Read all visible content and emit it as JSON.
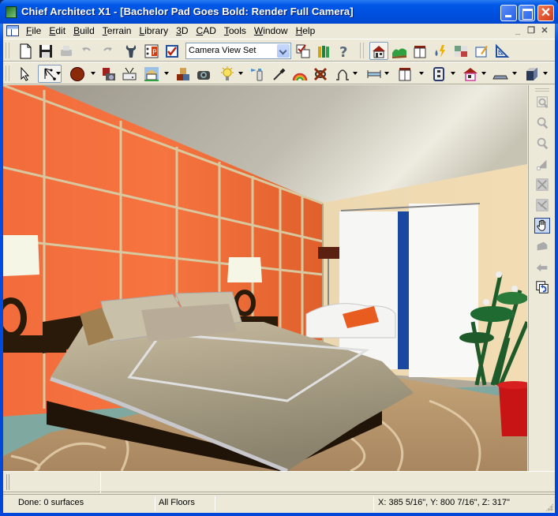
{
  "window": {
    "title": "Chief Architect X1 - [Bachelor Pad Goes Bold: Render Full Camera]",
    "controls": {
      "minimize": "minimize",
      "maximize": "maximize",
      "close": "✕"
    }
  },
  "menubar": {
    "items": [
      "File",
      "Edit",
      "Build",
      "Terrain",
      "Library",
      "3D",
      "CAD",
      "Tools",
      "Window",
      "Help"
    ],
    "mdi_controls": {
      "minimize": "_",
      "restore": "❐",
      "close": "✕"
    }
  },
  "toolbar1": {
    "buttons": [
      "new-document",
      "save",
      "print",
      "undo",
      "redo",
      "preferences",
      "plan-footprint",
      "check-select"
    ],
    "view_set": {
      "selected": "Camera View Set"
    },
    "buttons_after": [
      "select-objects-toggle",
      "library-browser",
      "help"
    ],
    "mode_buttons": [
      "floor-plan-mode",
      "terrain-mode",
      "cabinet-mode",
      "electrical-plumbing-mode",
      "materials-mode",
      "cad-mode",
      "layout-mode"
    ]
  },
  "toolbar2": {
    "buttons": [
      "select-arrow",
      "edit-handles",
      "material-ball",
      "camera-save",
      "print-render",
      "house-view",
      "blocks",
      "camera",
      "light",
      "paint-spray",
      "eyedropper",
      "rainbow",
      "delete-x",
      "arc-tool",
      "dimension",
      "cabinet",
      "outlet",
      "house-pink",
      "slab",
      "cube"
    ]
  },
  "side_toolbar": {
    "buttons": [
      "zoom-window",
      "zoom-in",
      "zoom-out",
      "fill-window",
      "fill-window-building",
      "fill-window-all",
      "pan-hand",
      "walk",
      "rotate",
      "undo-zoom"
    ]
  },
  "lower_area": {},
  "statusbar": {
    "status": "Done:  0 surfaces",
    "floors": "All Floors",
    "empty": "",
    "coordinates": "X: 385 5/16\", Y: 800 7/16\", Z: 317\""
  },
  "scene": {
    "description": "3D rendered bedroom with orange paneled accent wall, bed with beige duvet, white armchair, curtains, potted plant, patterned rug",
    "colors": {
      "accent_wall": "#f06a38",
      "trim": "#d8c8a0",
      "ceiling": "#a8a498",
      "side_wall": "#eed8b0",
      "duvet": "#c0b498",
      "bed_frame": "#2a1a0a",
      "rug": "#b89870",
      "floor": "#7ea8a0",
      "plant_pot": "#c81414"
    }
  }
}
